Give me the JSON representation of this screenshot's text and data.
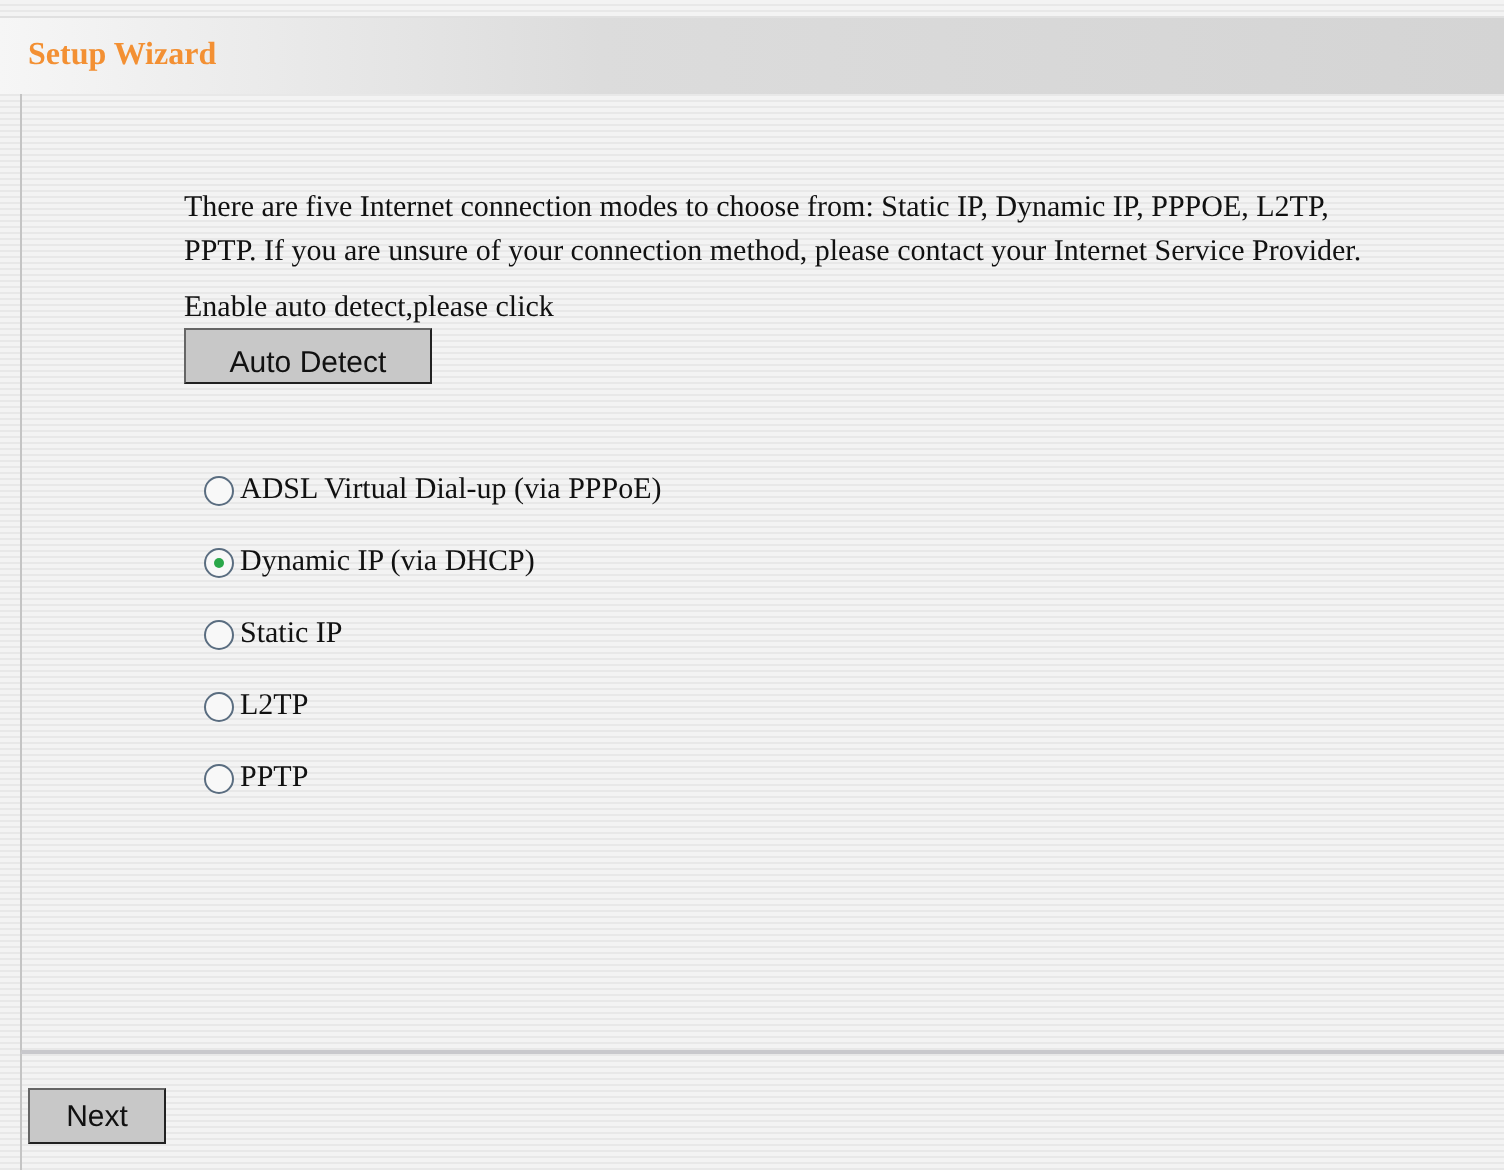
{
  "header": {
    "title": "Setup Wizard"
  },
  "intro": "There are five Internet connection modes to choose from: Static IP, Dynamic IP, PPPOE, L2TP, PPTP. If you are unsure of your connection method, please contact your Internet Service Provider.",
  "auto_detect": {
    "label": "Enable auto detect,please click",
    "button": "Auto Detect"
  },
  "modes": [
    {
      "label": "ADSL Virtual Dial-up (via PPPoE)",
      "selected": false
    },
    {
      "label": "Dynamic IP (via DHCP)",
      "selected": true
    },
    {
      "label": "Static IP",
      "selected": false
    },
    {
      "label": "L2TP",
      "selected": false
    },
    {
      "label": "PPTP",
      "selected": false
    }
  ],
  "buttons": {
    "next": "Next"
  }
}
